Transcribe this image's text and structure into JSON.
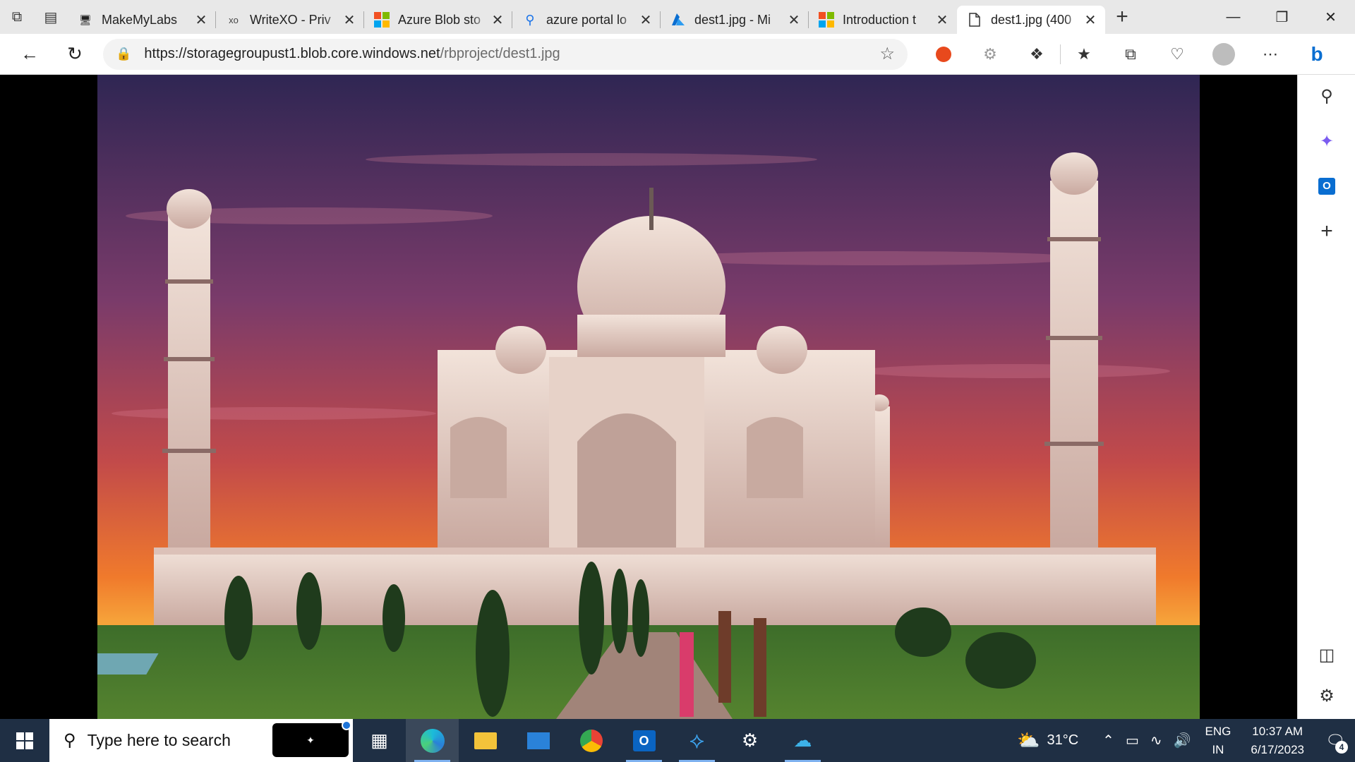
{
  "browser": {
    "tabs": [
      {
        "title": "MakeMyLabs",
        "icon": "monitor-icon"
      },
      {
        "title": "WriteXO - Priv",
        "icon": "xo-icon"
      },
      {
        "title": "Azure Blob sto",
        "icon": "microsoft-logo-icon"
      },
      {
        "title": "azure portal lo",
        "icon": "search-icon"
      },
      {
        "title": "dest1.jpg - Mi",
        "icon": "azure-icon"
      },
      {
        "title": "Introduction t",
        "icon": "microsoft-logo-icon"
      },
      {
        "title": "dest1.jpg (400",
        "icon": "file-icon",
        "active": true
      }
    ],
    "xo_label": "xo",
    "url_host": "https://storagegroupust1.blob.core.windows.net",
    "url_path": "/rbproject/dest1.jpg"
  },
  "image": {
    "subject": "taj-mahal-at-sunset",
    "sky_top": "#3b2b5c",
    "sky_bottom": "#f27a2a",
    "marble": "#ead8d0"
  },
  "taskbar": {
    "search_placeholder": "Type here to search",
    "weather_temp": "31°C",
    "lang_line1": "ENG",
    "lang_line2": "IN",
    "time": "10:37 AM",
    "date": "6/17/2023",
    "notification_count": "4"
  },
  "colors": {
    "taskbar_bg": "#1f2f44",
    "tabbar_bg": "#e8e8e8",
    "accent": "#0078d4"
  }
}
